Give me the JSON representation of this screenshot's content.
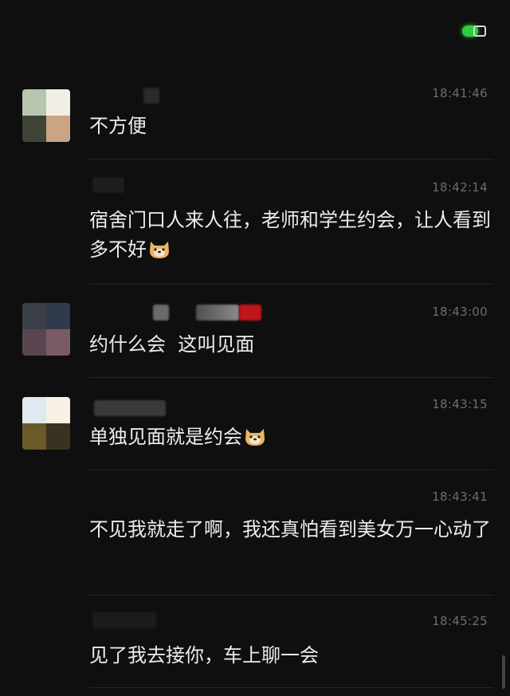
{
  "messages": [
    {
      "time": "18:41:46",
      "text": "不方便",
      "emoji": false
    },
    {
      "time": "18:42:14",
      "text": "宿舍门口人来人往，老师和学生约会，让人看到多不好",
      "emoji": true
    },
    {
      "time": "18:43:00",
      "text": "约什么会  这叫见面",
      "emoji": false
    },
    {
      "time": "18:43:15",
      "text": "单独见面就是约会",
      "emoji": true
    },
    {
      "time": "18:43:41",
      "text": "不见我就走了啊，我还真怕看到美女万一心动了",
      "emoji": false
    },
    {
      "time": "18:45:25",
      "text": "见了我去接你，车上聊一会",
      "emoji": false
    }
  ],
  "emoji_name": "doge-emoji",
  "colors": {
    "background": "#0f0f0f",
    "text": "#ececec",
    "time": "#6d6d6d",
    "battery": "#2ecc40"
  }
}
